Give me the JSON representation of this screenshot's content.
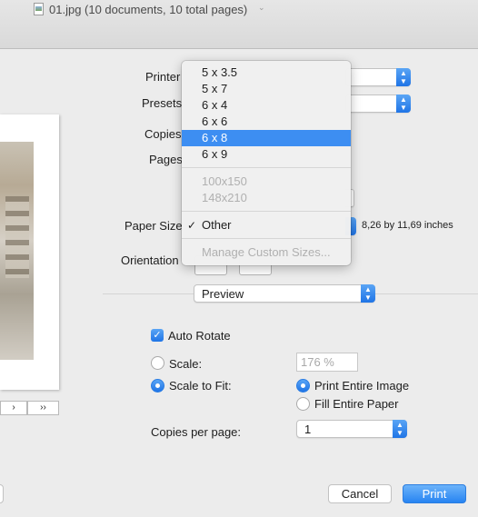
{
  "window": {
    "title": "01.jpg (10 documents, 10 total pages)"
  },
  "preview": {
    "nav_prev": "›",
    "nav_last": "››"
  },
  "labels": {
    "printer": "Printer",
    "presets": "Presets",
    "copies": "Copies",
    "pages": "Pages",
    "paper_size": "Paper Size",
    "orientation": "Orientation"
  },
  "paper_size_info": "8,26 by 11,69 inches",
  "section_popup": {
    "value": "Preview"
  },
  "options": {
    "auto_rotate": {
      "label": "Auto Rotate",
      "checked": true
    },
    "scale": {
      "label": "Scale:",
      "value": "176 %"
    },
    "scale_to_fit": {
      "label": "Scale to Fit:",
      "selected": true
    },
    "print_entire_image": {
      "label": "Print Entire Image",
      "selected": true
    },
    "fill_entire_paper": {
      "label": "Fill Entire Paper",
      "selected": false
    },
    "copies_per_page": {
      "label": "Copies per page:",
      "value": "1"
    }
  },
  "buttons": {
    "cancel": "Cancel",
    "print": "Print"
  },
  "paper_menu": {
    "items": [
      {
        "label": "5 x 3.5"
      },
      {
        "label": "5 x 7"
      },
      {
        "label": "6 x 4"
      },
      {
        "label": "6 x 6"
      },
      {
        "label": "6 x 8"
      },
      {
        "label": "6 x 9"
      },
      {
        "label": "100x150"
      },
      {
        "label": "148x210"
      },
      {
        "label": "Other"
      },
      {
        "label": "Manage Custom Sizes..."
      }
    ],
    "checkmark": "✓",
    "selected_highlight": "6 x 8",
    "checked_item": "Other"
  },
  "colors": {
    "accent": "#3d8ef2",
    "print_button": "#2784f2"
  }
}
